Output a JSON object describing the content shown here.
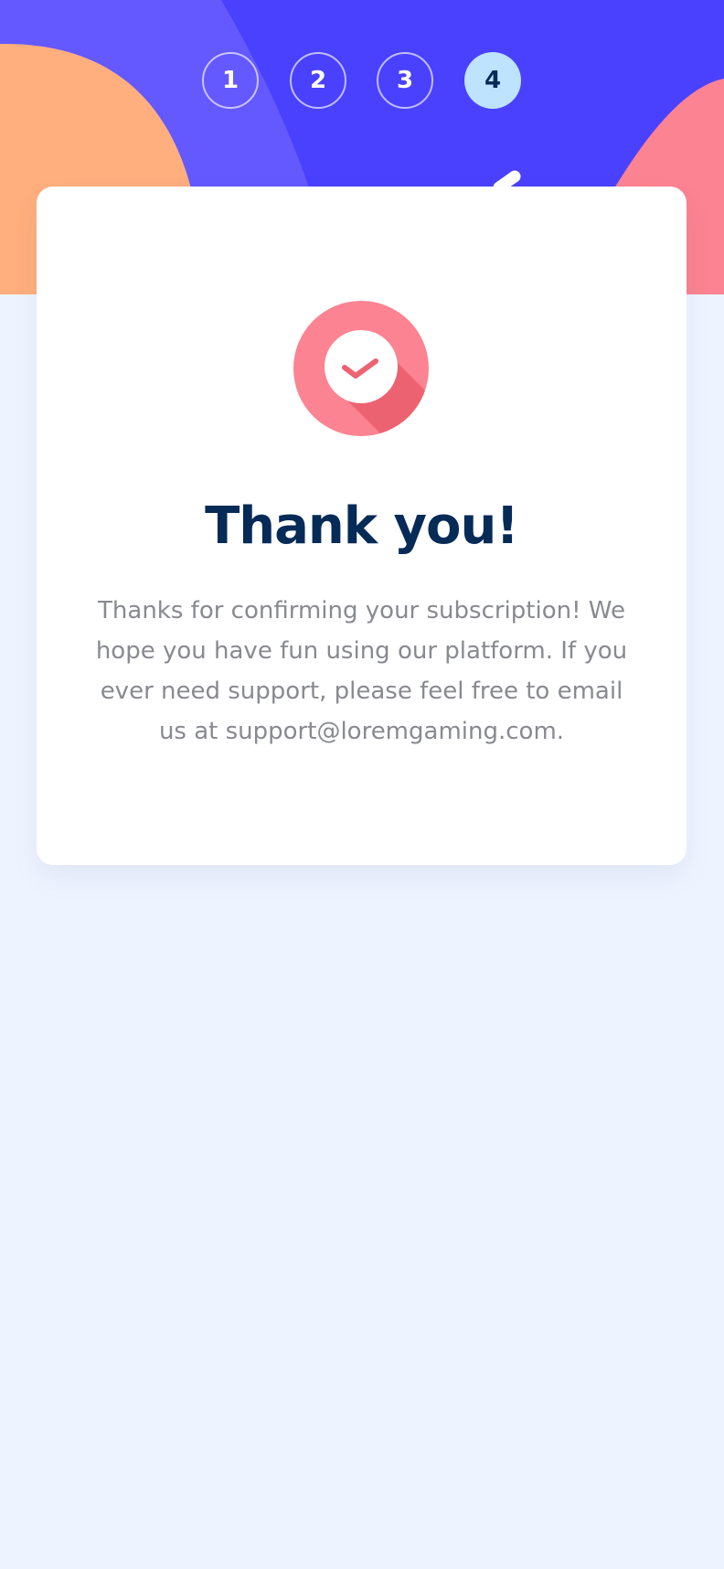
{
  "colors": {
    "page_background": "#EEF4FF",
    "header_primary": "#4A41FF",
    "header_secondary": "#6458FF",
    "orange_blob": "#FFAF7D",
    "pink_blob": "#FC8391",
    "active_step_background": "#BEE3FF",
    "title": "#072B57",
    "body_text": "#888A8F",
    "icon_circle": "#FC8391",
    "icon_shadow": "#ED6271",
    "icon_check": "#EE6272"
  },
  "steps": [
    {
      "label": "1",
      "active": false
    },
    {
      "label": "2",
      "active": false
    },
    {
      "label": "3",
      "active": false
    },
    {
      "label": "4",
      "active": true
    }
  ],
  "card": {
    "icon": "check-circle-icon",
    "title": "Thank you!",
    "message": "Thanks for confirming your subscription! We hope you have fun using our platform. If you ever need support, please feel free to email us at support@loremgaming.com."
  }
}
